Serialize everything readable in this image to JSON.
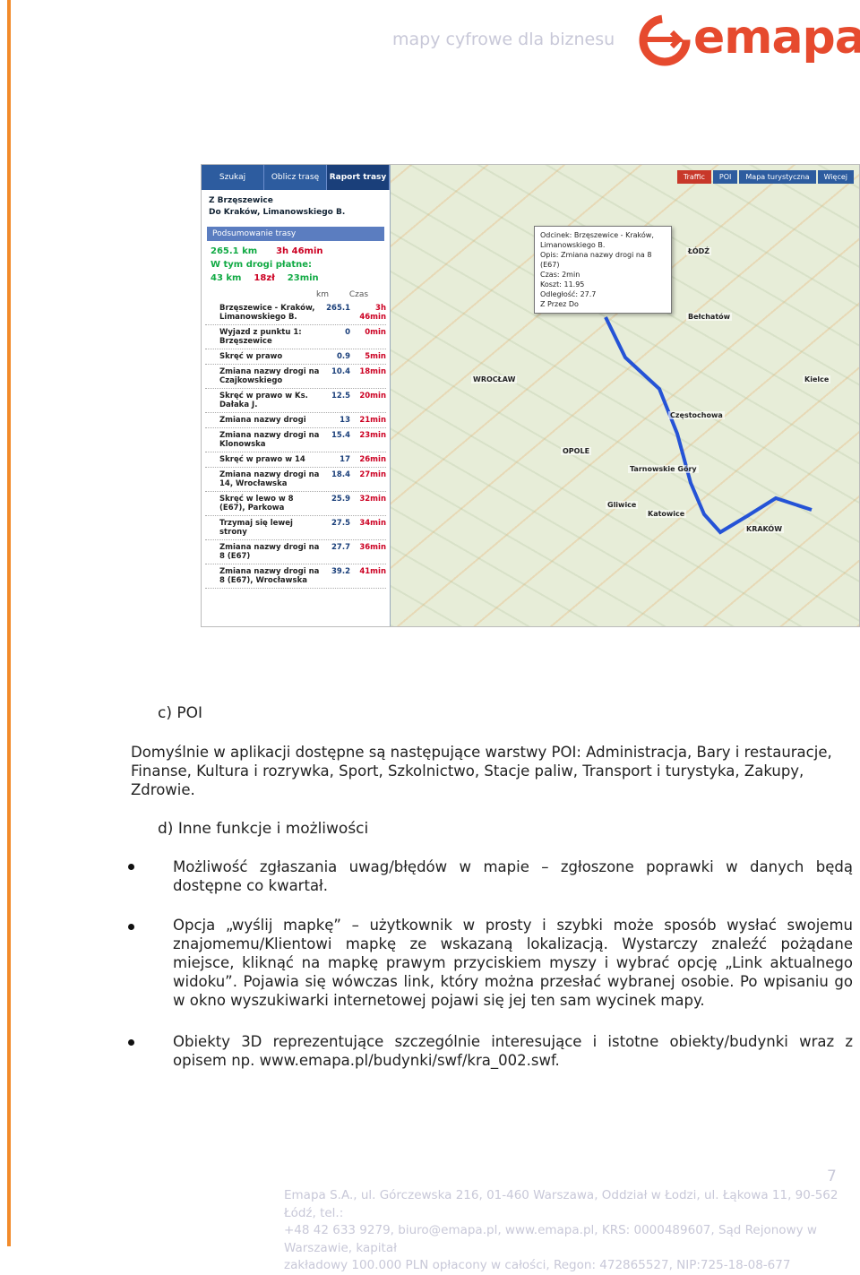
{
  "header": {
    "tagline": "mapy cyfrowe dla biznesu",
    "logo_text": "emapa",
    "brand_color": "#e64a2e",
    "accent_color": "#f28b2b"
  },
  "screenshot": {
    "tabs": [
      "Szukaj",
      "Oblicz trasę",
      "Raport trasy"
    ],
    "route_from": "Z Brzęszewice",
    "route_to": "Do Kraków, Limanowskiego B.",
    "summary_label": "Podsumowanie trasy",
    "total_km": "265.1 km",
    "total_time": "3h 46min",
    "paid_label": "W tym drogi płatne:",
    "paid_km": "43 km",
    "paid_cost": "18zł",
    "paid_time": "23min",
    "col_km": "km",
    "col_time": "Czas",
    "steps": [
      {
        "desc": "Brzęszewice - Kraków, Limanowskiego B.",
        "km": "265.1",
        "time": "3h 46min"
      },
      {
        "desc": "Wyjazd z punktu 1: Brzęszewice",
        "km": "0",
        "time": "0min"
      },
      {
        "desc": "Skręć w prawo",
        "km": "0.9",
        "time": "5min"
      },
      {
        "desc": "Zmiana nazwy drogi na Czajkowskiego",
        "km": "10.4",
        "time": "18min"
      },
      {
        "desc": "Skręć w prawo w Ks. Dałaka J.",
        "km": "12.5",
        "time": "20min"
      },
      {
        "desc": "Zmiana nazwy drogi",
        "km": "13",
        "time": "21min"
      },
      {
        "desc": "Zmiana nazwy drogi na Klonowska",
        "km": "15.4",
        "time": "23min"
      },
      {
        "desc": "Skręć w prawo w 14",
        "km": "17",
        "time": "26min"
      },
      {
        "desc": "Zmiana nazwy drogi na 14, Wrocławska",
        "km": "18.4",
        "time": "27min"
      },
      {
        "desc": "Skręć w lewo w 8 (E67), Parkowa",
        "km": "25.9",
        "time": "32min"
      },
      {
        "desc": "Trzymaj się lewej strony",
        "km": "27.5",
        "time": "34min"
      },
      {
        "desc": "Zmiana nazwy drogi na 8 (E67)",
        "km": "27.7",
        "time": "36min"
      },
      {
        "desc": "Zmiana nazwy drogi na 8 (E67), Wrocławska",
        "km": "39.2",
        "time": "41min"
      }
    ],
    "map_buttons": [
      "Traffic",
      "POI",
      "Mapa turystyczna",
      "Więcej"
    ],
    "popup_lines": [
      "Odcinek: Brzęszewice - Kraków, Limanowskiego B.",
      "Opis: Zmiana nazwy drogi na 8 (E67)",
      "Czas: 2min",
      "Koszt: 11.95",
      "Odległość: 27.7",
      "Z  Przez  Do"
    ],
    "cities": [
      "WROCŁAW",
      "OPOLE",
      "ŁÓDŹ",
      "KRAKÓW",
      "Częstochowa",
      "Katowice",
      "Gliwice",
      "Tarnowskie Góry",
      "Bełchatów",
      "Kielce"
    ]
  },
  "section_c": {
    "heading": "c)  POI",
    "paragraph": "Domyślnie w aplikacji dostępne są następujące warstwy POI: Administracja, Bary i restauracje, Finanse, Kultura i rozrywka, Sport, Szkolnictwo, Stacje paliw, Transport i turystyka, Zakupy, Zdrowie."
  },
  "section_d": {
    "heading": "d)  Inne funkcje i możliwości",
    "bullets": [
      "Możliwość zgłaszania uwag/błędów w mapie – zgłoszone poprawki w danych będą dostępne co kwartał.",
      "Opcja „wyślij mapkę” – użytkownik w prosty i szybki może sposób wysłać swojemu znajomemu/Klientowi mapkę ze wskazaną lokalizacją. Wystarczy znaleźć pożądane miejsce, kliknąć na mapkę prawym przyciskiem myszy i wybrać opcję „Link aktualnego widoku”. Pojawia się wówczas link, który można przesłać wybranej osobie. Po wpisaniu go w okno wyszukiwarki internetowej pojawi się jej ten sam wycinek mapy.",
      "Obiekty 3D reprezentujące szczególnie interesujące i istotne obiekty/budynki wraz z opisem np. www.emapa.pl/budynki/swf/kra_002.swf."
    ]
  },
  "footer": {
    "page_number": "7",
    "lines": [
      "Emapa S.A., ul. Górczewska 216, 01-460 Warszawa, Oddział w Łodzi, ul. Łąkowa 11, 90-562 Łódź, tel.:",
      "+48 42 633 9279, biuro@emapa.pl, www.emapa.pl, KRS: 0000489607, Sąd Rejonowy w Warszawie, kapitał",
      "zakładowy 100.000 PLN opłacony w całości, Regon: 472865527, NIP:725-18-08-677"
    ]
  }
}
